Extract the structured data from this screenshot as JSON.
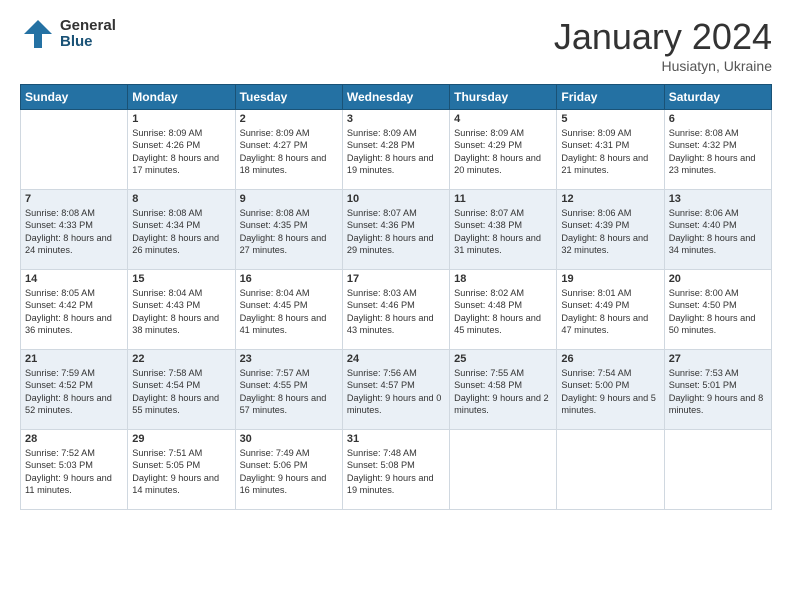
{
  "header": {
    "logo_general": "General",
    "logo_blue": "Blue",
    "title": "January 2024",
    "subtitle": "Husiatyn, Ukraine"
  },
  "days_of_week": [
    "Sunday",
    "Monday",
    "Tuesday",
    "Wednesday",
    "Thursday",
    "Friday",
    "Saturday"
  ],
  "weeks": [
    [
      {
        "day": "",
        "sunrise": "",
        "sunset": "",
        "daylight": ""
      },
      {
        "day": "1",
        "sunrise": "Sunrise: 8:09 AM",
        "sunset": "Sunset: 4:26 PM",
        "daylight": "Daylight: 8 hours and 17 minutes."
      },
      {
        "day": "2",
        "sunrise": "Sunrise: 8:09 AM",
        "sunset": "Sunset: 4:27 PM",
        "daylight": "Daylight: 8 hours and 18 minutes."
      },
      {
        "day": "3",
        "sunrise": "Sunrise: 8:09 AM",
        "sunset": "Sunset: 4:28 PM",
        "daylight": "Daylight: 8 hours and 19 minutes."
      },
      {
        "day": "4",
        "sunrise": "Sunrise: 8:09 AM",
        "sunset": "Sunset: 4:29 PM",
        "daylight": "Daylight: 8 hours and 20 minutes."
      },
      {
        "day": "5",
        "sunrise": "Sunrise: 8:09 AM",
        "sunset": "Sunset: 4:31 PM",
        "daylight": "Daylight: 8 hours and 21 minutes."
      },
      {
        "day": "6",
        "sunrise": "Sunrise: 8:08 AM",
        "sunset": "Sunset: 4:32 PM",
        "daylight": "Daylight: 8 hours and 23 minutes."
      }
    ],
    [
      {
        "day": "7",
        "sunrise": "Sunrise: 8:08 AM",
        "sunset": "Sunset: 4:33 PM",
        "daylight": "Daylight: 8 hours and 24 minutes."
      },
      {
        "day": "8",
        "sunrise": "Sunrise: 8:08 AM",
        "sunset": "Sunset: 4:34 PM",
        "daylight": "Daylight: 8 hours and 26 minutes."
      },
      {
        "day": "9",
        "sunrise": "Sunrise: 8:08 AM",
        "sunset": "Sunset: 4:35 PM",
        "daylight": "Daylight: 8 hours and 27 minutes."
      },
      {
        "day": "10",
        "sunrise": "Sunrise: 8:07 AM",
        "sunset": "Sunset: 4:36 PM",
        "daylight": "Daylight: 8 hours and 29 minutes."
      },
      {
        "day": "11",
        "sunrise": "Sunrise: 8:07 AM",
        "sunset": "Sunset: 4:38 PM",
        "daylight": "Daylight: 8 hours and 31 minutes."
      },
      {
        "day": "12",
        "sunrise": "Sunrise: 8:06 AM",
        "sunset": "Sunset: 4:39 PM",
        "daylight": "Daylight: 8 hours and 32 minutes."
      },
      {
        "day": "13",
        "sunrise": "Sunrise: 8:06 AM",
        "sunset": "Sunset: 4:40 PM",
        "daylight": "Daylight: 8 hours and 34 minutes."
      }
    ],
    [
      {
        "day": "14",
        "sunrise": "Sunrise: 8:05 AM",
        "sunset": "Sunset: 4:42 PM",
        "daylight": "Daylight: 8 hours and 36 minutes."
      },
      {
        "day": "15",
        "sunrise": "Sunrise: 8:04 AM",
        "sunset": "Sunset: 4:43 PM",
        "daylight": "Daylight: 8 hours and 38 minutes."
      },
      {
        "day": "16",
        "sunrise": "Sunrise: 8:04 AM",
        "sunset": "Sunset: 4:45 PM",
        "daylight": "Daylight: 8 hours and 41 minutes."
      },
      {
        "day": "17",
        "sunrise": "Sunrise: 8:03 AM",
        "sunset": "Sunset: 4:46 PM",
        "daylight": "Daylight: 8 hours and 43 minutes."
      },
      {
        "day": "18",
        "sunrise": "Sunrise: 8:02 AM",
        "sunset": "Sunset: 4:48 PM",
        "daylight": "Daylight: 8 hours and 45 minutes."
      },
      {
        "day": "19",
        "sunrise": "Sunrise: 8:01 AM",
        "sunset": "Sunset: 4:49 PM",
        "daylight": "Daylight: 8 hours and 47 minutes."
      },
      {
        "day": "20",
        "sunrise": "Sunrise: 8:00 AM",
        "sunset": "Sunset: 4:50 PM",
        "daylight": "Daylight: 8 hours and 50 minutes."
      }
    ],
    [
      {
        "day": "21",
        "sunrise": "Sunrise: 7:59 AM",
        "sunset": "Sunset: 4:52 PM",
        "daylight": "Daylight: 8 hours and 52 minutes."
      },
      {
        "day": "22",
        "sunrise": "Sunrise: 7:58 AM",
        "sunset": "Sunset: 4:54 PM",
        "daylight": "Daylight: 8 hours and 55 minutes."
      },
      {
        "day": "23",
        "sunrise": "Sunrise: 7:57 AM",
        "sunset": "Sunset: 4:55 PM",
        "daylight": "Daylight: 8 hours and 57 minutes."
      },
      {
        "day": "24",
        "sunrise": "Sunrise: 7:56 AM",
        "sunset": "Sunset: 4:57 PM",
        "daylight": "Daylight: 9 hours and 0 minutes."
      },
      {
        "day": "25",
        "sunrise": "Sunrise: 7:55 AM",
        "sunset": "Sunset: 4:58 PM",
        "daylight": "Daylight: 9 hours and 2 minutes."
      },
      {
        "day": "26",
        "sunrise": "Sunrise: 7:54 AM",
        "sunset": "Sunset: 5:00 PM",
        "daylight": "Daylight: 9 hours and 5 minutes."
      },
      {
        "day": "27",
        "sunrise": "Sunrise: 7:53 AM",
        "sunset": "Sunset: 5:01 PM",
        "daylight": "Daylight: 9 hours and 8 minutes."
      }
    ],
    [
      {
        "day": "28",
        "sunrise": "Sunrise: 7:52 AM",
        "sunset": "Sunset: 5:03 PM",
        "daylight": "Daylight: 9 hours and 11 minutes."
      },
      {
        "day": "29",
        "sunrise": "Sunrise: 7:51 AM",
        "sunset": "Sunset: 5:05 PM",
        "daylight": "Daylight: 9 hours and 14 minutes."
      },
      {
        "day": "30",
        "sunrise": "Sunrise: 7:49 AM",
        "sunset": "Sunset: 5:06 PM",
        "daylight": "Daylight: 9 hours and 16 minutes."
      },
      {
        "day": "31",
        "sunrise": "Sunrise: 7:48 AM",
        "sunset": "Sunset: 5:08 PM",
        "daylight": "Daylight: 9 hours and 19 minutes."
      },
      {
        "day": "",
        "sunrise": "",
        "sunset": "",
        "daylight": ""
      },
      {
        "day": "",
        "sunrise": "",
        "sunset": "",
        "daylight": ""
      },
      {
        "day": "",
        "sunrise": "",
        "sunset": "",
        "daylight": ""
      }
    ]
  ]
}
